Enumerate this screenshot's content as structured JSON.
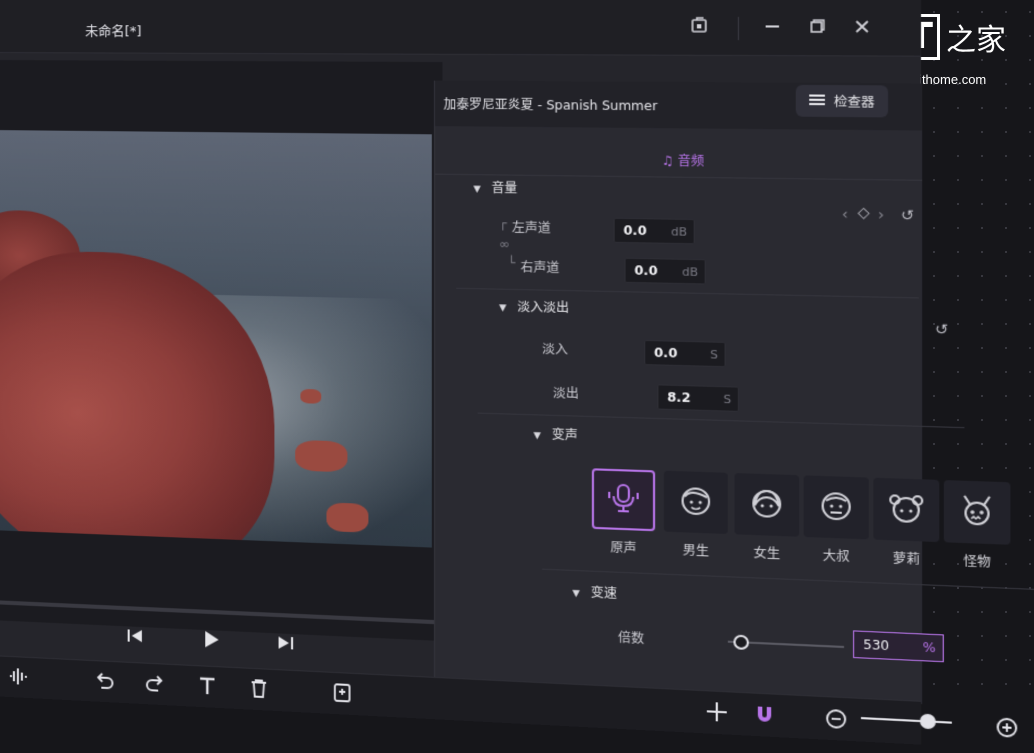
{
  "window": {
    "title": "未命名[*]"
  },
  "clip": {
    "name": "加泰罗尼亚炎夏 - Spanish Summer"
  },
  "inspector": {
    "button_label": "检查器"
  },
  "tabs": {
    "audio": "音频"
  },
  "volume": {
    "title": "音量",
    "left_label": "左声道",
    "left_value": "0.0",
    "left_unit": "dB",
    "right_label": "右声道",
    "right_value": "0.0",
    "right_unit": "dB"
  },
  "fade": {
    "title": "淡入淡出",
    "in_label": "淡入",
    "in_value": "0.0",
    "in_unit": "S",
    "out_label": "淡出",
    "out_value": "8.2",
    "out_unit": "S"
  },
  "voice_change": {
    "title": "变声",
    "options": [
      {
        "label": "原声",
        "selected": true
      },
      {
        "label": "男生",
        "selected": false
      },
      {
        "label": "女生",
        "selected": false
      },
      {
        "label": "大叔",
        "selected": false
      },
      {
        "label": "萝莉",
        "selected": false
      },
      {
        "label": "怪物",
        "selected": false
      }
    ]
  },
  "speed": {
    "title": "变速",
    "pitch_label": "倍数",
    "pitch_value": "530",
    "pitch_unit": "%",
    "pitch_level": 0.05
  },
  "watermark": {
    "logo_it": "IT",
    "logo_cn": "之家",
    "url": "www.ithome.com"
  },
  "colors": {
    "accent": "#b774e8",
    "panel_bg": "#2a2a31",
    "window_bg": "#25252b"
  }
}
